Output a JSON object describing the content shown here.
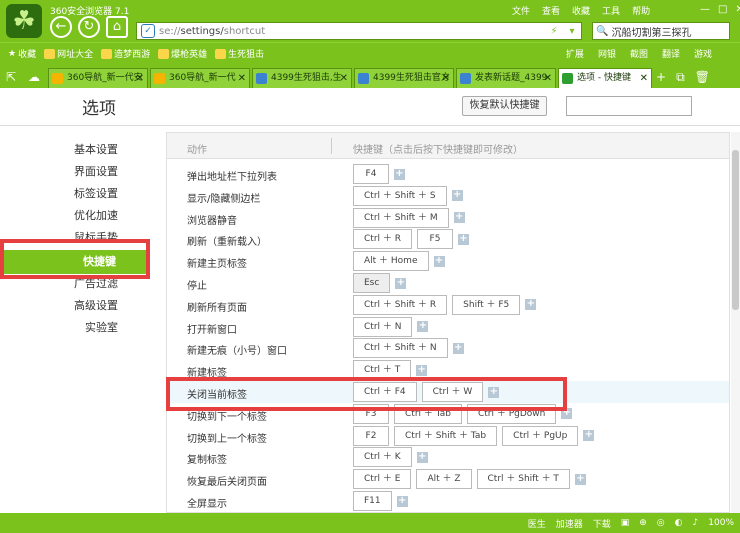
{
  "browser": {
    "title": "360安全浏览器 7.1",
    "logo_glyph": "☘",
    "menu": [
      "文件",
      "查看",
      "收藏",
      "工具",
      "帮助"
    ],
    "window_controls": [
      "—",
      "□",
      "✕"
    ],
    "nav": {
      "back": "←",
      "refresh": "↻",
      "home": "⌂"
    },
    "address_scheme": "se://",
    "address_host": "settings/",
    "address_path": "shortcut",
    "search_placeholder": "沉船切割第三探孔"
  },
  "bookmarks": {
    "items": [
      "收藏",
      "网址大全",
      "造梦西游",
      "爆枪英雄",
      "生死狙击"
    ],
    "right": [
      "扩展",
      "网银",
      "截图",
      "翻译",
      "游戏"
    ]
  },
  "tabs": [
    {
      "label": "360导航_新一代安",
      "icon_color": "#f5b400"
    },
    {
      "label": "360导航_新一代",
      "icon_color": "#f5b400"
    },
    {
      "label": "4399生死狙击,生",
      "icon_color": "#3b82d1"
    },
    {
      "label": "4399生死狙击官方",
      "icon_color": "#3b82d1"
    },
    {
      "label": "发表新话题_4399",
      "icon_color": "#3b82d1"
    },
    {
      "label": "选项 - 快捷键",
      "icon_color": "#2e9f2e"
    }
  ],
  "tab_icons": [
    "+",
    "⧉",
    "🗑"
  ],
  "options": {
    "title": "选项",
    "reset_label": "恢复默认快捷键",
    "sidebar": [
      "基本设置",
      "界面设置",
      "标签设置",
      "优化加速",
      "鼠标手势",
      "快捷键",
      "广告过滤",
      "高级设置",
      "实验室"
    ],
    "active_index": 5,
    "col_action": "动作",
    "col_shortcut": "快捷键（点击后按下快捷键即可修改）"
  },
  "shortcuts": [
    {
      "action": "弹出地址栏下拉列表",
      "keys": [
        "F4"
      ],
      "highlight": false
    },
    {
      "action": "显示/隐藏侧边栏",
      "keys": [
        "Ctrl ＋ Shift ＋ S"
      ],
      "highlight": false
    },
    {
      "action": "浏览器静音",
      "keys": [
        "Ctrl ＋ Shift ＋ M"
      ],
      "highlight": false
    },
    {
      "action": "刷新（重新载入）",
      "keys": [
        "Ctrl ＋ R",
        "F5"
      ],
      "highlight": false
    },
    {
      "action": "新建主页标签",
      "keys": [
        "Alt ＋ Home"
      ],
      "highlight": false
    },
    {
      "action": "停止",
      "keys": [
        "Esc"
      ],
      "highlight": false,
      "gray": true
    },
    {
      "action": "刷新所有页面",
      "keys": [
        "Ctrl ＋ Shift ＋ R",
        "Shift ＋ F5"
      ],
      "highlight": false
    },
    {
      "action": "打开新窗口",
      "keys": [
        "Ctrl ＋ N"
      ],
      "highlight": false
    },
    {
      "action": "新建无痕（小号）窗口",
      "keys": [
        "Ctrl ＋ Shift ＋ N"
      ],
      "highlight": false
    },
    {
      "action": "新建标签",
      "keys": [
        "Ctrl ＋ T"
      ],
      "highlight": false
    },
    {
      "action": "关闭当前标签",
      "keys": [
        "Ctrl ＋ F4",
        "Ctrl ＋ W"
      ],
      "highlight": true
    },
    {
      "action": "切换到下一个标签",
      "keys": [
        "F3",
        "Ctrl ＋ Tab",
        "Ctrl ＋ PgDown"
      ],
      "highlight": false
    },
    {
      "action": "切换到上一个标签",
      "keys": [
        "F2",
        "Ctrl ＋ Shift ＋ Tab",
        "Ctrl ＋ PgUp"
      ],
      "highlight": false
    },
    {
      "action": "复制标签",
      "keys": [
        "Ctrl ＋ K"
      ],
      "highlight": false
    },
    {
      "action": "恢复最后关闭页面",
      "keys": [
        "Ctrl ＋ E",
        "Alt ＋ Z",
        "Ctrl ＋ Shift ＋ T"
      ],
      "highlight": false
    },
    {
      "action": "全屏显示",
      "keys": [
        "F11"
      ],
      "highlight": false
    }
  ],
  "statusbar": [
    "医生",
    "加速器",
    "下载",
    "",
    "",
    "",
    "",
    "",
    "100%"
  ],
  "colors": {
    "brand_green": "#7cc21c",
    "highlight_red": "#e53f3f"
  }
}
